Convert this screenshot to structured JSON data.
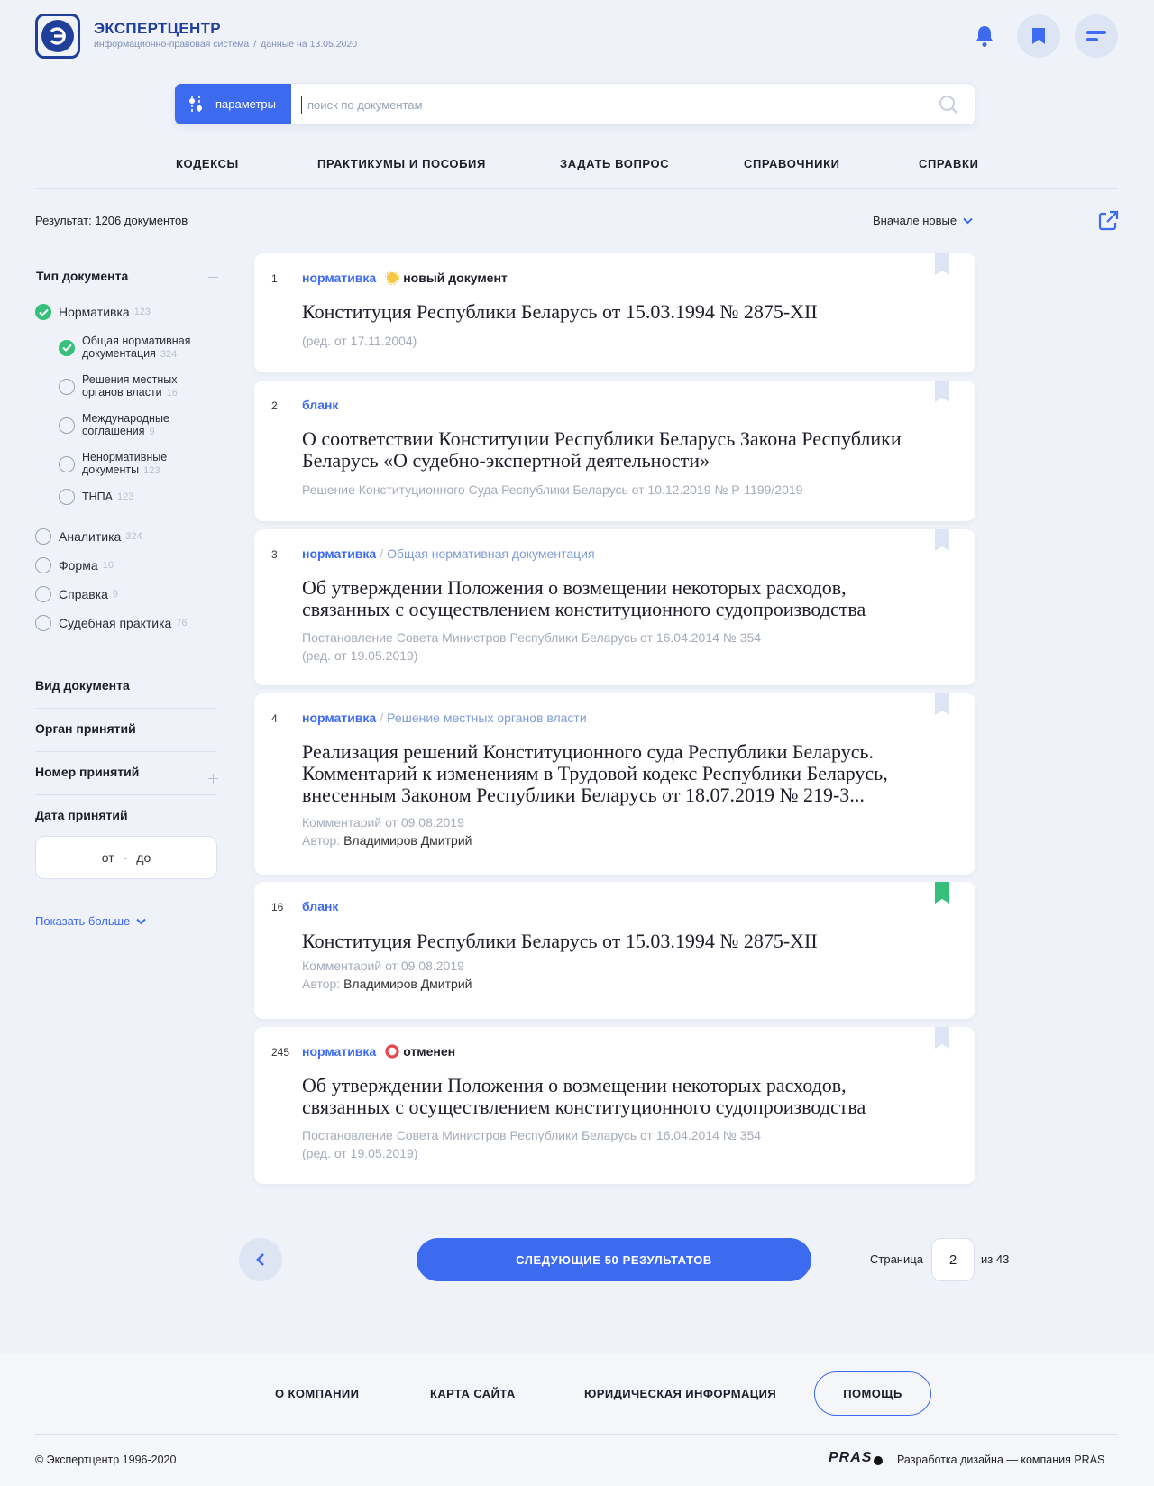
{
  "header": {
    "brand": "ЭКСПЕРТЦЕНТР",
    "subtitle": "информационно-правовая система",
    "data_date": "данные на 13.05.2020"
  },
  "search": {
    "params_label": "параметры",
    "placeholder": "поиск по документам"
  },
  "nav": [
    "КОДЕКСЫ",
    "ПРАКТИКУМЫ И ПОСОБИЯ",
    "ЗАДАТЬ ВОПРОС",
    "СПРАВОЧНИКИ",
    "СПРАВКИ"
  ],
  "results": {
    "count_text": "Результат: 1206 документов",
    "sort_label": "Вначале новые"
  },
  "sidebar": {
    "doc_type_title": "Тип документа",
    "types": [
      {
        "label": "Нормативка",
        "count": "123",
        "checked": true
      },
      {
        "label": "Аналитика",
        "count": "324",
        "checked": false
      },
      {
        "label": "Форма",
        "count": "16",
        "checked": false
      },
      {
        "label": "Справка",
        "count": "9",
        "checked": false
      },
      {
        "label": "Судебная практика",
        "count": "76",
        "checked": false
      }
    ],
    "subtypes": [
      {
        "line1": "Общая нормативная",
        "line2": "документация",
        "count": "324",
        "checked": true
      },
      {
        "line1": "Решения местных",
        "line2": "органов власти",
        "count": "16",
        "checked": false
      },
      {
        "line1": "Международные",
        "line2": "соглашения",
        "count": "9",
        "checked": false
      },
      {
        "line1": "Ненормативные",
        "line2": "документы",
        "count": "123",
        "checked": false
      },
      {
        "line1": "ТНПА",
        "line2": "",
        "count": "123",
        "checked": false
      }
    ],
    "kind_title": "Вид документа",
    "organ_title": "Орган принятий",
    "number_title": "Номер принятий",
    "date_title": "Дата принятий",
    "date_from": "от",
    "date_dash": "-",
    "date_to": "до",
    "show_more": "Показать больше"
  },
  "cards": [
    {
      "num": "1",
      "tag": "нормативка",
      "badge": "новый документ",
      "title": "Конституция Республики Беларусь от 15.03.1994 № 2875-XII",
      "meta1": "(ред. от 17.11.2004)"
    },
    {
      "num": "2",
      "tag": "бланк",
      "title_l1": "О соответствии Конституции Республики Беларусь Закона Республики",
      "title_l2": "Беларусь «О судебно-экспертной деятельности»",
      "meta1": "Решение Конституционного Суда Республики Беларусь от 10.12.2019 № Р-1199/2019"
    },
    {
      "num": "3",
      "tag": "нормативка",
      "subtag": "Общая нормативная документация",
      "title_l1": "Об утверждении Положения о возмещении некоторых расходов,",
      "title_l2": "связанных с осуществлением конституционного судопроизводства",
      "meta1": "Постановление Совета Министров Республики Беларусь от 16.04.2014 № 354",
      "meta2": "(ред. от 19.05.2019)"
    },
    {
      "num": "4",
      "tag": "нормативка",
      "subtag": "Решение местных органов власти",
      "title_l1": "Реализация решений Конституционного суда Республики Беларусь.",
      "title_l2": "Комментарий к изменениям в Трудовой кодекс Республики Беларусь,",
      "title_l3": "внесенным Законом Республики Беларусь от 18.07.2019 № 219-З...",
      "meta1": "Комментарий от 09.08.2019",
      "author_label": "Автор:",
      "author": "Владимиров Дмитрий"
    },
    {
      "num": "16",
      "tag": "бланк",
      "title": "Конституция Республики Беларусь от 15.03.1994 № 2875-XII",
      "meta1": "Комментарий от 09.08.2019",
      "author_label": "Автор:",
      "author": "Владимиров Дмитрий"
    },
    {
      "num": "245",
      "tag": "нормативка",
      "badge": "отменен",
      "title_l1": "Об утверждении Положения о возмещении некоторых расходов,",
      "title_l2": "связанных с осуществлением конституционного судопроизводства",
      "meta1": "Постановление Совета Министров Республики Беларусь от 16.04.2014 № 354",
      "meta2": "(ред. от 19.05.2019)"
    }
  ],
  "pagination": {
    "next_label": "СЛЕДУЮЩИЕ 50 РЕЗУЛЬТАТОВ",
    "page_label": "Страница",
    "page_value": "2",
    "total": "из 43"
  },
  "footer": {
    "links": [
      "О КОМПАНИИ",
      "КАРТА САЙТА",
      "ЮРИДИЧЕСКАЯ ИНФОРМАЦИЯ"
    ],
    "help": "ПОМОЩЬ",
    "copyright": "© Экспертцентр 1996-2020",
    "pras": "PRAS",
    "developer": "Разработка дизайна — компания PRAS"
  },
  "colors": {
    "accent": "#3d6bf0",
    "brand": "#1f3f9a",
    "check": "#36c07c",
    "bookmark_active": "#36c07c",
    "cancel": "#e5484d"
  }
}
